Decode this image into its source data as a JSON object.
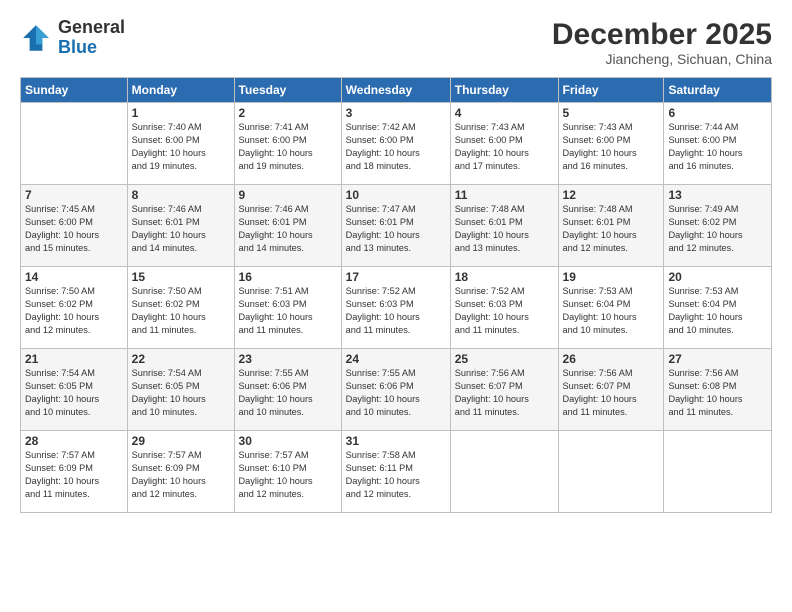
{
  "header": {
    "logo_general": "General",
    "logo_blue": "Blue",
    "title": "December 2025",
    "location": "Jiancheng, Sichuan, China"
  },
  "weekdays": [
    "Sunday",
    "Monday",
    "Tuesday",
    "Wednesday",
    "Thursday",
    "Friday",
    "Saturday"
  ],
  "weeks": [
    [
      {
        "day": "",
        "info": ""
      },
      {
        "day": "1",
        "info": "Sunrise: 7:40 AM\nSunset: 6:00 PM\nDaylight: 10 hours\nand 19 minutes."
      },
      {
        "day": "2",
        "info": "Sunrise: 7:41 AM\nSunset: 6:00 PM\nDaylight: 10 hours\nand 19 minutes."
      },
      {
        "day": "3",
        "info": "Sunrise: 7:42 AM\nSunset: 6:00 PM\nDaylight: 10 hours\nand 18 minutes."
      },
      {
        "day": "4",
        "info": "Sunrise: 7:43 AM\nSunset: 6:00 PM\nDaylight: 10 hours\nand 17 minutes."
      },
      {
        "day": "5",
        "info": "Sunrise: 7:43 AM\nSunset: 6:00 PM\nDaylight: 10 hours\nand 16 minutes."
      },
      {
        "day": "6",
        "info": "Sunrise: 7:44 AM\nSunset: 6:00 PM\nDaylight: 10 hours\nand 16 minutes."
      }
    ],
    [
      {
        "day": "7",
        "info": "Sunrise: 7:45 AM\nSunset: 6:00 PM\nDaylight: 10 hours\nand 15 minutes."
      },
      {
        "day": "8",
        "info": "Sunrise: 7:46 AM\nSunset: 6:01 PM\nDaylight: 10 hours\nand 14 minutes."
      },
      {
        "day": "9",
        "info": "Sunrise: 7:46 AM\nSunset: 6:01 PM\nDaylight: 10 hours\nand 14 minutes."
      },
      {
        "day": "10",
        "info": "Sunrise: 7:47 AM\nSunset: 6:01 PM\nDaylight: 10 hours\nand 13 minutes."
      },
      {
        "day": "11",
        "info": "Sunrise: 7:48 AM\nSunset: 6:01 PM\nDaylight: 10 hours\nand 13 minutes."
      },
      {
        "day": "12",
        "info": "Sunrise: 7:48 AM\nSunset: 6:01 PM\nDaylight: 10 hours\nand 12 minutes."
      },
      {
        "day": "13",
        "info": "Sunrise: 7:49 AM\nSunset: 6:02 PM\nDaylight: 10 hours\nand 12 minutes."
      }
    ],
    [
      {
        "day": "14",
        "info": "Sunrise: 7:50 AM\nSunset: 6:02 PM\nDaylight: 10 hours\nand 12 minutes."
      },
      {
        "day": "15",
        "info": "Sunrise: 7:50 AM\nSunset: 6:02 PM\nDaylight: 10 hours\nand 11 minutes."
      },
      {
        "day": "16",
        "info": "Sunrise: 7:51 AM\nSunset: 6:03 PM\nDaylight: 10 hours\nand 11 minutes."
      },
      {
        "day": "17",
        "info": "Sunrise: 7:52 AM\nSunset: 6:03 PM\nDaylight: 10 hours\nand 11 minutes."
      },
      {
        "day": "18",
        "info": "Sunrise: 7:52 AM\nSunset: 6:03 PM\nDaylight: 10 hours\nand 11 minutes."
      },
      {
        "day": "19",
        "info": "Sunrise: 7:53 AM\nSunset: 6:04 PM\nDaylight: 10 hours\nand 10 minutes."
      },
      {
        "day": "20",
        "info": "Sunrise: 7:53 AM\nSunset: 6:04 PM\nDaylight: 10 hours\nand 10 minutes."
      }
    ],
    [
      {
        "day": "21",
        "info": "Sunrise: 7:54 AM\nSunset: 6:05 PM\nDaylight: 10 hours\nand 10 minutes."
      },
      {
        "day": "22",
        "info": "Sunrise: 7:54 AM\nSunset: 6:05 PM\nDaylight: 10 hours\nand 10 minutes."
      },
      {
        "day": "23",
        "info": "Sunrise: 7:55 AM\nSunset: 6:06 PM\nDaylight: 10 hours\nand 10 minutes."
      },
      {
        "day": "24",
        "info": "Sunrise: 7:55 AM\nSunset: 6:06 PM\nDaylight: 10 hours\nand 10 minutes."
      },
      {
        "day": "25",
        "info": "Sunrise: 7:56 AM\nSunset: 6:07 PM\nDaylight: 10 hours\nand 11 minutes."
      },
      {
        "day": "26",
        "info": "Sunrise: 7:56 AM\nSunset: 6:07 PM\nDaylight: 10 hours\nand 11 minutes."
      },
      {
        "day": "27",
        "info": "Sunrise: 7:56 AM\nSunset: 6:08 PM\nDaylight: 10 hours\nand 11 minutes."
      }
    ],
    [
      {
        "day": "28",
        "info": "Sunrise: 7:57 AM\nSunset: 6:09 PM\nDaylight: 10 hours\nand 11 minutes."
      },
      {
        "day": "29",
        "info": "Sunrise: 7:57 AM\nSunset: 6:09 PM\nDaylight: 10 hours\nand 12 minutes."
      },
      {
        "day": "30",
        "info": "Sunrise: 7:57 AM\nSunset: 6:10 PM\nDaylight: 10 hours\nand 12 minutes."
      },
      {
        "day": "31",
        "info": "Sunrise: 7:58 AM\nSunset: 6:11 PM\nDaylight: 10 hours\nand 12 minutes."
      },
      {
        "day": "",
        "info": ""
      },
      {
        "day": "",
        "info": ""
      },
      {
        "day": "",
        "info": ""
      }
    ]
  ]
}
